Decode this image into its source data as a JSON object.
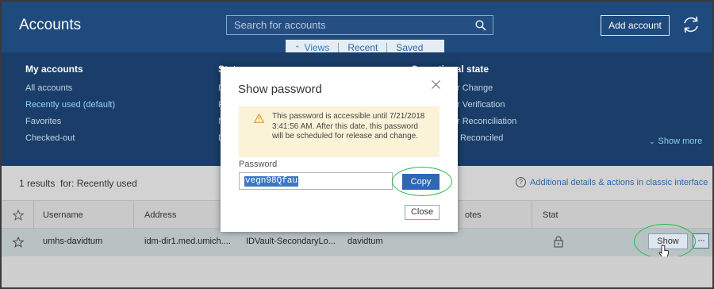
{
  "header": {
    "title": "Accounts",
    "search_placeholder": "Search for accounts",
    "add_account_label": "Add account"
  },
  "view_tabs": [
    "Views",
    "Recent",
    "Saved"
  ],
  "filters": {
    "my_accounts": {
      "title": "My accounts",
      "items": [
        "All accounts",
        "Recently used (default)",
        "Favorites",
        "Checked-out"
      ]
    },
    "status": {
      "title": "Status",
      "items": [
        "D",
        "F",
        "N",
        "D"
      ]
    },
    "operational_state": {
      "title": "Operational state",
      "items": [
        "r Change",
        "r Verification",
        "r Reconciliation",
        "Reconciled"
      ]
    },
    "show_more": "Show more"
  },
  "results": {
    "count_text": "1 results",
    "for_text": "for: Recently used",
    "classic_link": "Additional details & actions in classic interface"
  },
  "table": {
    "columns": [
      "Username",
      "Address",
      "",
      "",
      "otes",
      "Stat"
    ],
    "rows": [
      {
        "username": "umhs-davidtum",
        "address": "idm-dir1.med.umich....",
        "platform": "IDVault-SecondaryLo...",
        "logon": "davidtum",
        "show_label": "Show",
        "more_label": "···"
      }
    ]
  },
  "modal": {
    "title": "Show password",
    "warning_text": "This password is accessible until 7/21/2018 3:41:56 AM. After this date, this password will be scheduled for release and change.",
    "password_label": "Password",
    "password_value": "vegn98Qfau",
    "copy_label": "Copy",
    "close_label": "Close"
  },
  "colors": {
    "header_bg": "#1e4a7e",
    "panel_bg": "#1a3e69",
    "accent_link": "#8fd4f4",
    "primary_button": "#2f67b2",
    "highlight_ring": "#29b84a",
    "warning_bg": "#fbf3d8"
  }
}
